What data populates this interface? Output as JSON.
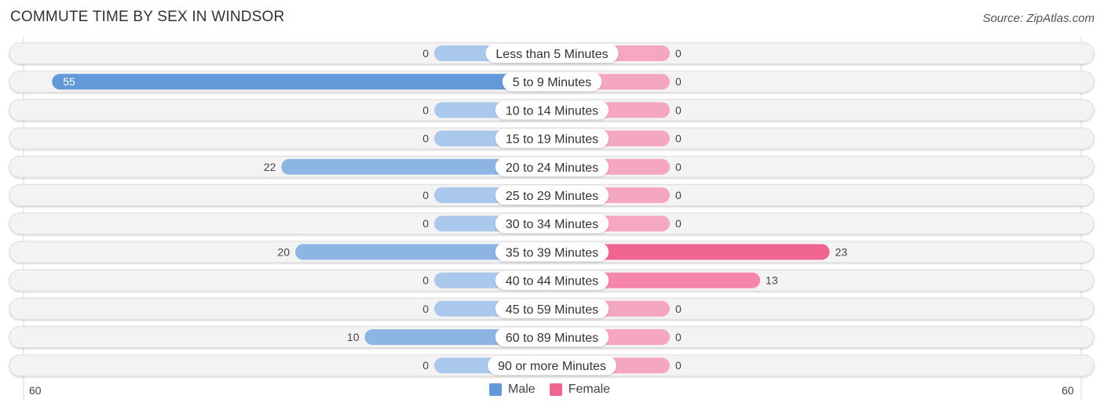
{
  "title": "COMMUTE TIME BY SEX IN WINDSOR",
  "source": "Source: ZipAtlas.com",
  "colors": {
    "male_strong": "#6399d8",
    "male_light": "#a9c8ec",
    "female_strong": "#f06590",
    "female_light": "#f6a7c0",
    "track": "#f3f3f3"
  },
  "chart_data": {
    "type": "bar",
    "orientation": "horizontal-diverging",
    "title": "COMMUTE TIME BY SEX IN WINDSOR",
    "categories": [
      "Less than 5 Minutes",
      "5 to 9 Minutes",
      "10 to 14 Minutes",
      "15 to 19 Minutes",
      "20 to 24 Minutes",
      "25 to 29 Minutes",
      "30 to 34 Minutes",
      "35 to 39 Minutes",
      "40 to 44 Minutes",
      "45 to 59 Minutes",
      "60 to 89 Minutes",
      "90 or more Minutes"
    ],
    "series": [
      {
        "name": "Male",
        "values": [
          0,
          55,
          0,
          0,
          22,
          0,
          0,
          20,
          0,
          0,
          10,
          0
        ]
      },
      {
        "name": "Female",
        "values": [
          0,
          0,
          0,
          0,
          0,
          0,
          0,
          23,
          13,
          0,
          0,
          0
        ]
      }
    ],
    "axis": {
      "left_label": "60",
      "right_label": "60",
      "range": [
        0,
        60
      ]
    },
    "legend": {
      "position": "bottom-center",
      "entries": [
        "Male",
        "Female"
      ]
    }
  }
}
